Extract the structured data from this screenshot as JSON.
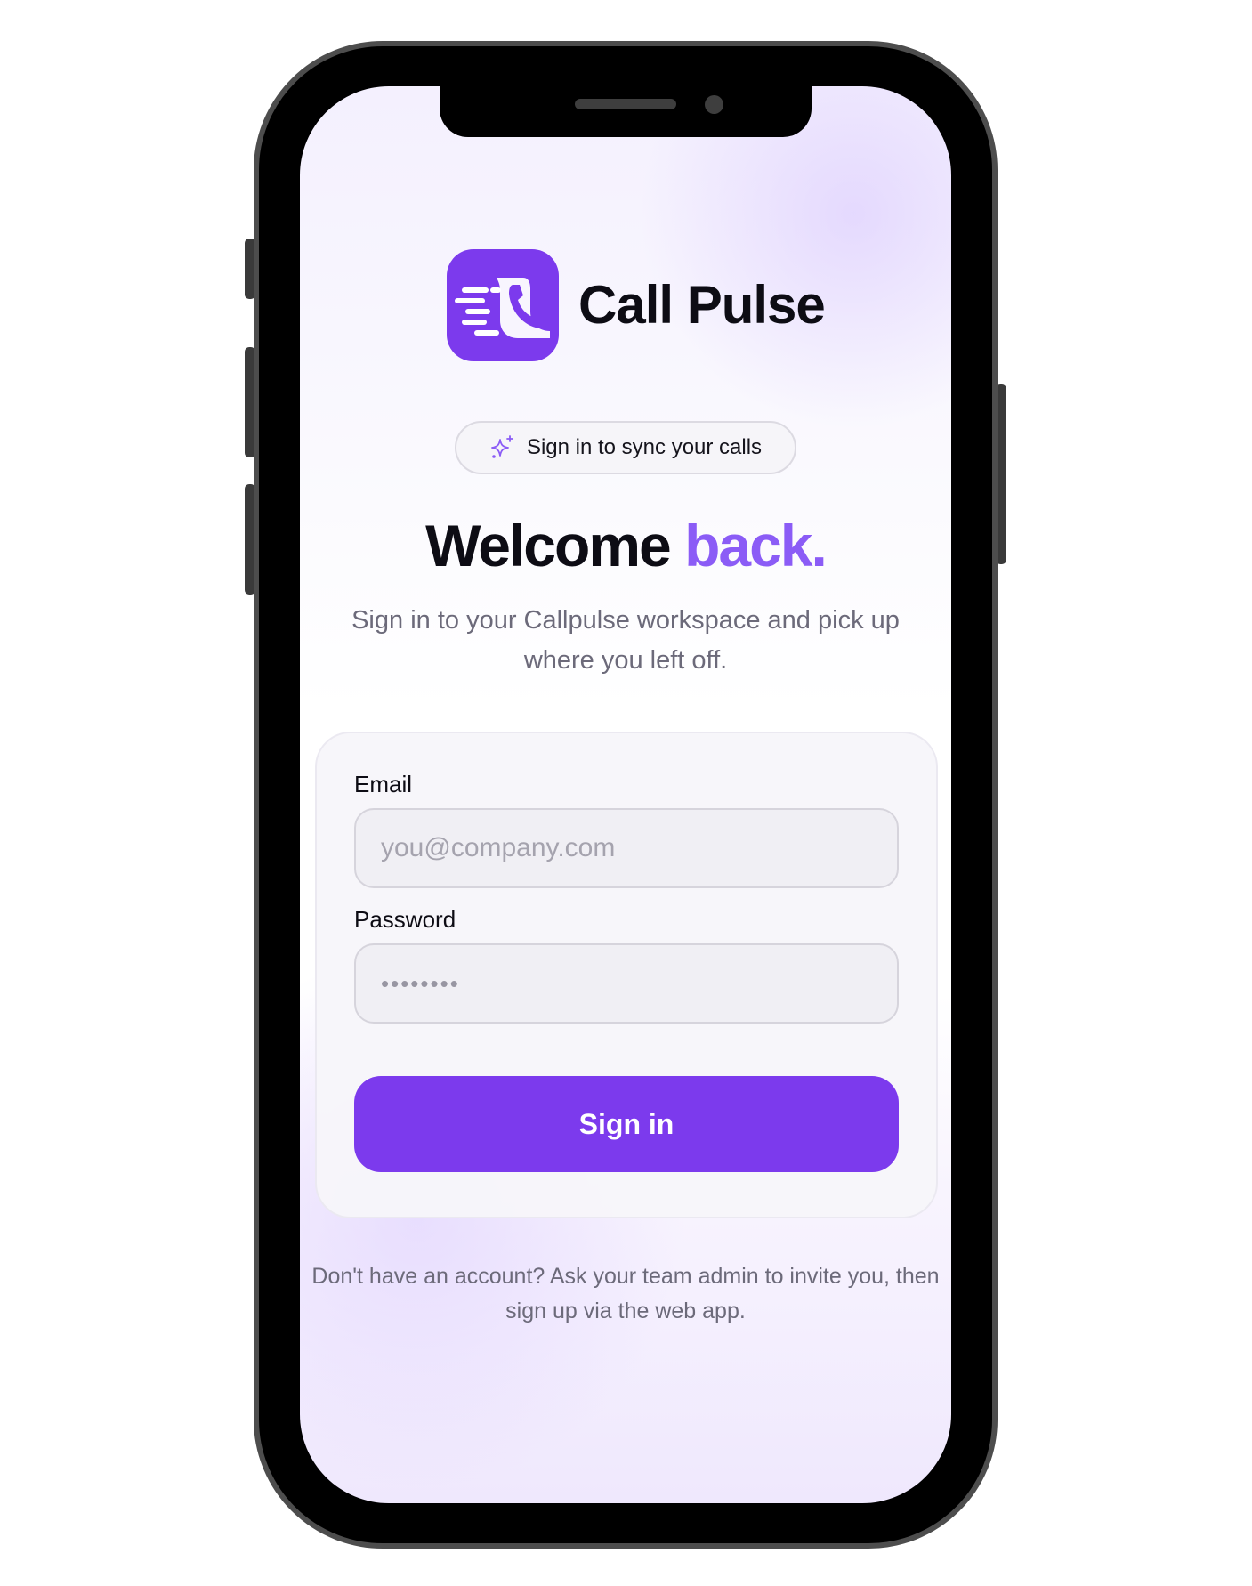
{
  "app": {
    "name": "Call Pulse",
    "logo_icon": "phone-speed-icon",
    "accent_color": "#7c3aed"
  },
  "badge": {
    "icon": "sparkles-icon",
    "label": "Sign in to sync your calls"
  },
  "headline": {
    "main": "Welcome",
    "accent": "back."
  },
  "subtitle": "Sign in to your Callpulse workspace and pick up where you left off.",
  "form": {
    "email_label": "Email",
    "email_placeholder": "you@company.com",
    "password_label": "Password",
    "password_placeholder": "••••••••",
    "submit_label": "Sign in"
  },
  "footer": "Don't have an account? Ask your team admin to invite you, then sign up via the web app."
}
